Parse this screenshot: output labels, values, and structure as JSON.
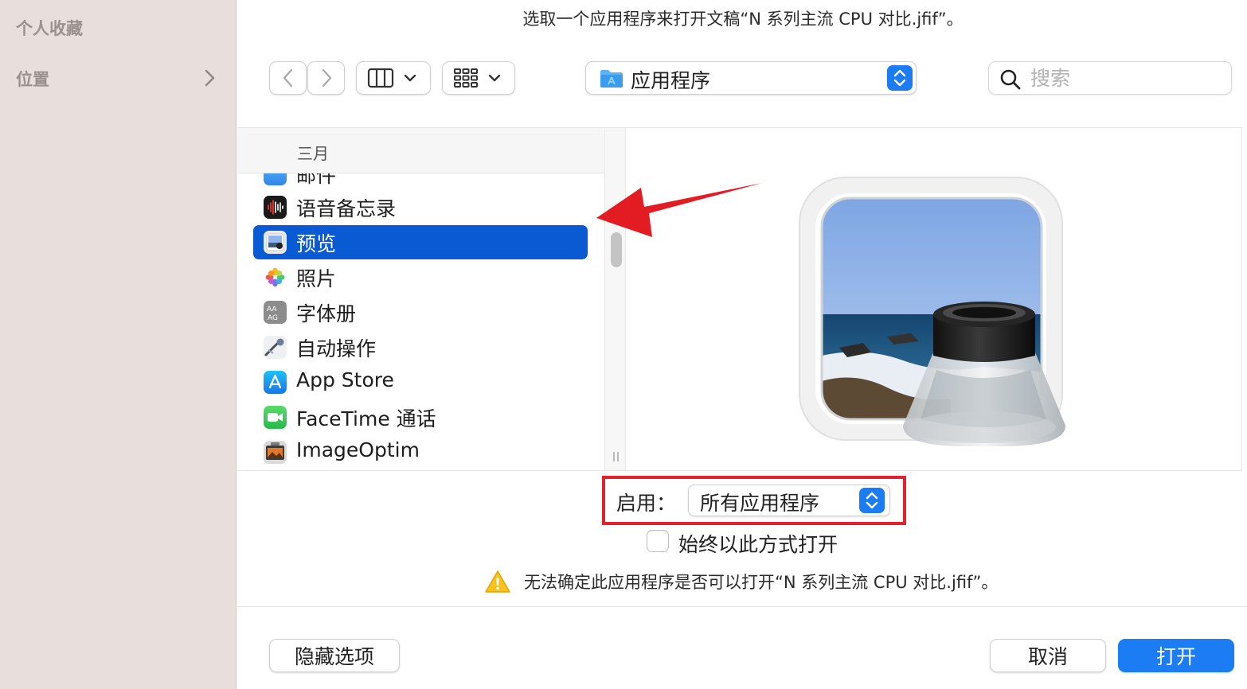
{
  "dialog_title": "选取一个应用程序来打开文稿“N 系列主流 CPU 对比.jfif”。",
  "sidebar": {
    "favorites_label": "个人收藏",
    "locations_label": "位置"
  },
  "toolbar": {
    "location": "应用程序",
    "search_placeholder": "搜索"
  },
  "list": {
    "section_header": "三月",
    "partial_item": "邮件",
    "items": [
      {
        "label": "语音备忘录",
        "icon": "voice-memos-icon",
        "selected": false
      },
      {
        "label": "预览",
        "icon": "preview-app-icon",
        "selected": true
      },
      {
        "label": "照片",
        "icon": "photos-icon",
        "selected": false
      },
      {
        "label": "字体册",
        "icon": "font-book-icon",
        "selected": false
      },
      {
        "label": "自动操作",
        "icon": "automator-icon",
        "selected": false
      },
      {
        "label": "App Store",
        "icon": "app-store-icon",
        "selected": false
      },
      {
        "label": "FaceTime 通话",
        "icon": "facetime-icon",
        "selected": false
      },
      {
        "label": "ImageOptim",
        "icon": "imageoptim-icon",
        "selected": false
      }
    ]
  },
  "enable": {
    "label": "启用：",
    "value": "所有应用程序"
  },
  "always_open_label": "始终以此方式打开",
  "warning": "无法确定此应用程序是否可以打开“N 系列主流 CPU 对比.jfif”。",
  "buttons": {
    "hide_options": "隐藏选项",
    "cancel": "取消",
    "open": "打开"
  },
  "colors": {
    "accent": "#1b7cf4",
    "selection": "#0a5ad4",
    "highlight_red": "#e3222f"
  }
}
